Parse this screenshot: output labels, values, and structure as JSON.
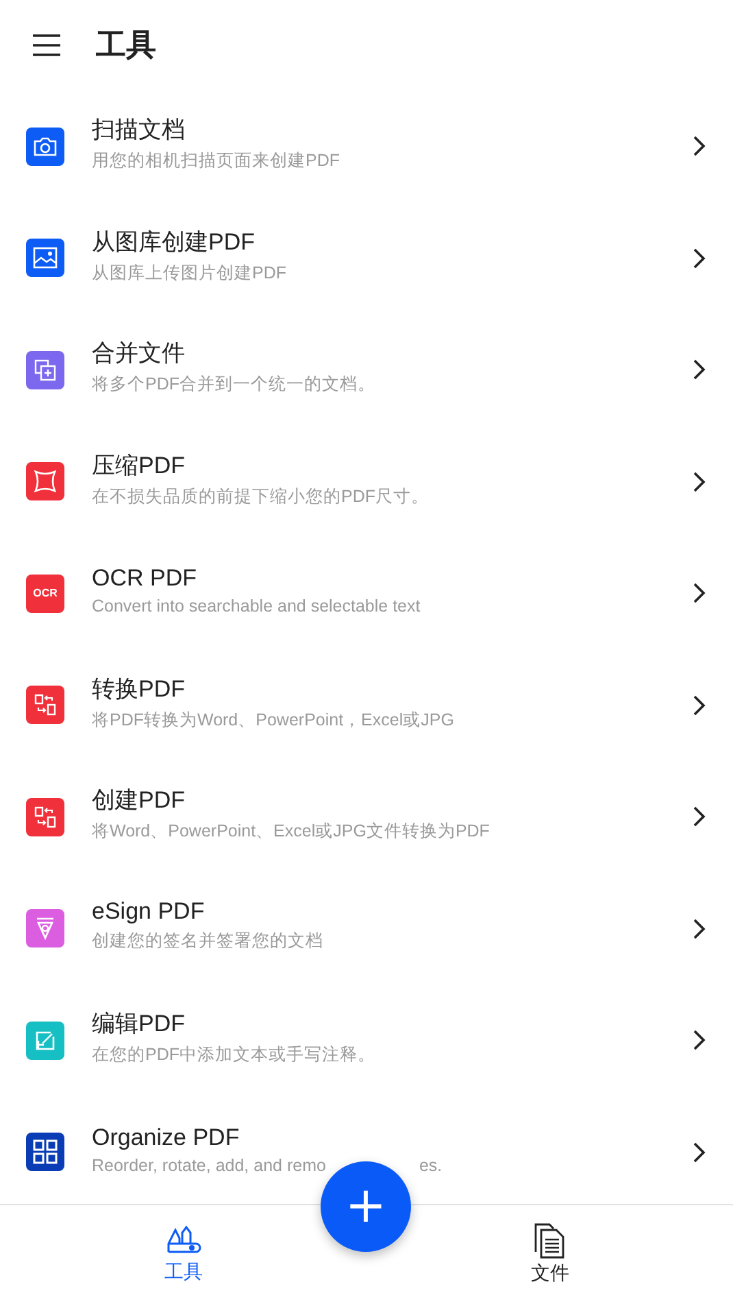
{
  "header": {
    "title": "工具"
  },
  "tools": [
    {
      "kind": "camera",
      "color": "#0d5cf5",
      "title": "扫描文档",
      "description": "用您的相机扫描页面来创建PDF"
    },
    {
      "kind": "image",
      "color": "#0d5cf5",
      "title": "从图库创建PDF",
      "description": "从图库上传图片创建PDF"
    },
    {
      "kind": "merge",
      "color": "#7b68ee",
      "title": "合并文件",
      "description": "将多个PDF合并到一个统一的文档。"
    },
    {
      "kind": "compress",
      "color": "#f0303a",
      "title": "压缩PDF",
      "description": "在不损失品质的前提下缩小您的PDF尺寸。"
    },
    {
      "kind": "ocr",
      "color": "#f0303a",
      "icon_text": "OCR",
      "title": "OCR PDF",
      "description": "Convert into searchable and selectable text"
    },
    {
      "kind": "convert",
      "color": "#f0303a",
      "title": "转换PDF",
      "description": "将PDF转换为Word、PowerPoint，Excel或JPG"
    },
    {
      "kind": "convert",
      "color": "#f0303a",
      "title": "创建PDF",
      "description": "将Word、PowerPoint、Excel或JPG文件转换为PDF"
    },
    {
      "kind": "esign",
      "color": "#dc5ee0",
      "title": "eSign PDF",
      "description": "创建您的签名并签署您的文档"
    },
    {
      "kind": "edit",
      "color": "#16bfc4",
      "title": "编辑PDF",
      "description": "在您的PDF中添加文本或手写注释。"
    },
    {
      "kind": "organize",
      "color": "#0a3db5",
      "title": "Organize PDF",
      "description": "Reorder, rotate, add, and remo",
      "description_tail": "es."
    }
  ],
  "fab": {
    "label": "+"
  },
  "nav": [
    {
      "kind": "tools",
      "label": "工具",
      "selected": true
    },
    {
      "kind": "files",
      "label": "文件",
      "selected": false
    }
  ]
}
